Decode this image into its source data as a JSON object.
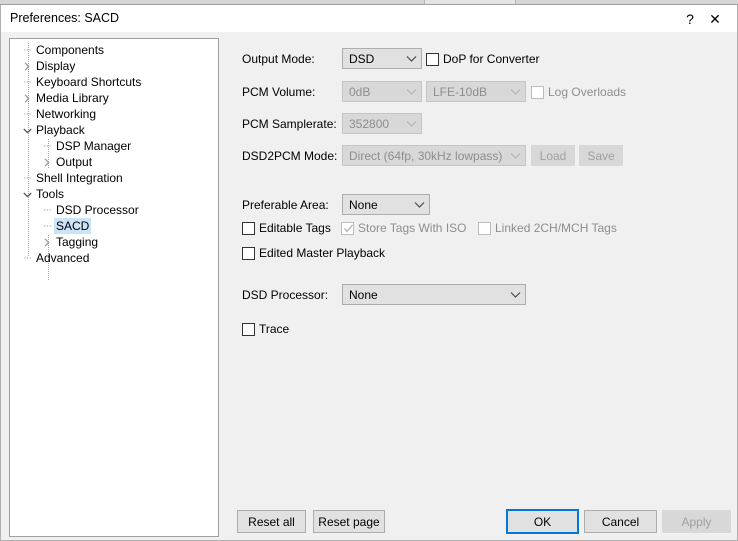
{
  "window": {
    "title": "Preferences: SACD",
    "help_icon": "question-mark-icon",
    "help_glyph": "?",
    "close_icon": "close-icon",
    "close_glyph": "✕"
  },
  "sidebar": {
    "items": [
      {
        "label": "Components",
        "level": 0,
        "expander": "none",
        "selected": false
      },
      {
        "label": "Display",
        "level": 0,
        "expander": "collapsed",
        "selected": false
      },
      {
        "label": "Keyboard Shortcuts",
        "level": 0,
        "expander": "none",
        "selected": false
      },
      {
        "label": "Media Library",
        "level": 0,
        "expander": "collapsed",
        "selected": false
      },
      {
        "label": "Networking",
        "level": 0,
        "expander": "none",
        "selected": false
      },
      {
        "label": "Playback",
        "level": 0,
        "expander": "expanded",
        "selected": false
      },
      {
        "label": "DSP Manager",
        "level": 1,
        "expander": "none",
        "selected": false
      },
      {
        "label": "Output",
        "level": 1,
        "expander": "collapsed",
        "selected": false
      },
      {
        "label": "Shell Integration",
        "level": 0,
        "expander": "none",
        "selected": false
      },
      {
        "label": "Tools",
        "level": 0,
        "expander": "expanded",
        "selected": false
      },
      {
        "label": "DSD Processor",
        "level": 1,
        "expander": "none",
        "selected": false
      },
      {
        "label": "SACD",
        "level": 1,
        "expander": "none",
        "selected": true
      },
      {
        "label": "Tagging",
        "level": 1,
        "expander": "collapsed",
        "selected": false
      },
      {
        "label": "Advanced",
        "level": 0,
        "expander": "none",
        "selected": false
      }
    ]
  },
  "form": {
    "output_mode": {
      "label": "Output Mode:",
      "value": "DSD",
      "enabled": true
    },
    "dop_for_converter": {
      "label": "DoP for Converter",
      "checked": false,
      "enabled": true
    },
    "pcm_volume": {
      "label": "PCM Volume:",
      "value": "0dB",
      "enabled": false
    },
    "lfe_gain": {
      "value": "LFE-10dB",
      "enabled": false
    },
    "log_overloads": {
      "label": "Log Overloads",
      "checked": false,
      "enabled": false
    },
    "pcm_samplerate": {
      "label": "PCM Samplerate:",
      "value": "352800",
      "enabled": false
    },
    "dsd2pcm_mode": {
      "label": "DSD2PCM Mode:",
      "value": "Direct (64fp, 30kHz lowpass)",
      "enabled": false
    },
    "load_button": {
      "label": "Load",
      "enabled": false
    },
    "save_button": {
      "label": "Save",
      "enabled": false
    },
    "preferable_area": {
      "label": "Preferable Area:",
      "value": "None",
      "enabled": true
    },
    "editable_tags": {
      "label": "Editable Tags",
      "checked": false,
      "enabled": true
    },
    "store_tags_with_iso": {
      "label": "Store Tags With ISO",
      "checked": true,
      "enabled": false
    },
    "linked_tags": {
      "label": "Linked 2CH/MCH Tags",
      "checked": false,
      "enabled": false
    },
    "edited_master_playback": {
      "label": "Edited Master Playback",
      "checked": false,
      "enabled": true
    },
    "dsd_processor": {
      "label": "DSD Processor:",
      "value": "None",
      "enabled": true
    },
    "trace": {
      "label": "Trace",
      "checked": false,
      "enabled": true
    }
  },
  "footer": {
    "reset_all": "Reset all",
    "reset_page": "Reset page",
    "ok": "OK",
    "cancel": "Cancel",
    "apply": "Apply",
    "apply_enabled": false
  },
  "colors": {
    "accent": "#0078d7",
    "selection": "#cce4f7",
    "dialog_bg": "#f0f0f0",
    "control_bg": "#e1e1e1",
    "disabled_text": "#8e8e8e"
  }
}
